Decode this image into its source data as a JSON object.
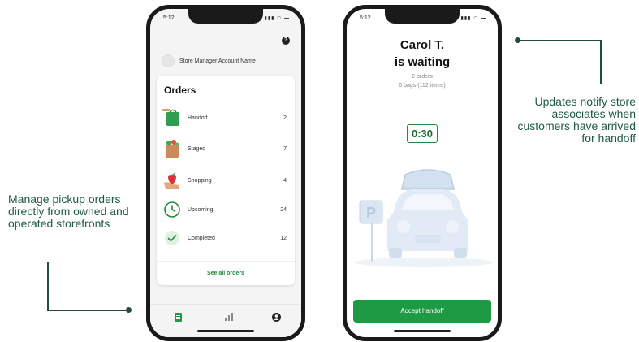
{
  "callouts": {
    "left": "Manage pickup orders directly from owned and operated storefronts",
    "right": "Updates notify store associates when customers have arrived for handoff"
  },
  "phone1": {
    "status_time": "5:12",
    "account_name": "Store Manager Account Name",
    "orders_title": "Orders",
    "orders": [
      {
        "label": "Handoff",
        "count": "2"
      },
      {
        "label": "Staged",
        "count": "7"
      },
      {
        "label": "Shopping",
        "count": "4"
      },
      {
        "label": "Upcoming",
        "count": "24"
      },
      {
        "label": "Completed",
        "count": "12"
      }
    ],
    "see_all": "See all orders",
    "tabs": [
      "orders-icon",
      "stats-icon",
      "profile-icon"
    ]
  },
  "phone2": {
    "status_time": "5:12",
    "customer_line1": "Carol T.",
    "customer_line2": "is waiting",
    "orders_count": "2 orders",
    "bags": "6 bags (112 items)",
    "timer": "0:30",
    "parking_sign": "P",
    "accept_label": "Accept handoff"
  },
  "colors": {
    "accent_green": "#1e9a44",
    "callout_text": "#1f5a45",
    "phone_frame": "#1a1a1a"
  }
}
